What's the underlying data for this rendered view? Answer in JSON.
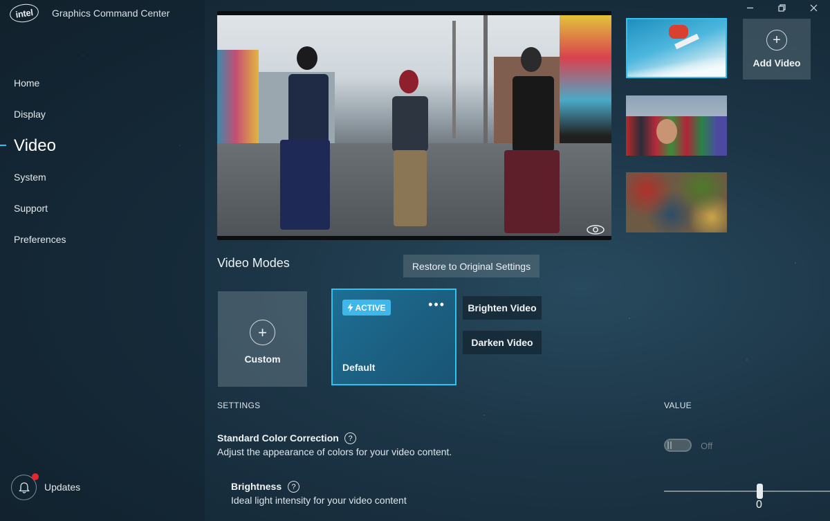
{
  "app": {
    "logo": "intel",
    "title": "Graphics Command Center"
  },
  "nav": {
    "items": [
      {
        "label": "Home"
      },
      {
        "label": "Display"
      },
      {
        "label": "Video",
        "active": true
      },
      {
        "label": "System"
      },
      {
        "label": "Support"
      },
      {
        "label": "Preferences"
      }
    ],
    "updates_label": "Updates",
    "accent_color": "#2ec4f0"
  },
  "window_controls": {
    "icons": [
      "minimize-icon",
      "restore-icon",
      "close-icon"
    ]
  },
  "preview": {
    "overlay_icon": "eye-icon"
  },
  "thumbnails": {
    "items": [
      {
        "subject": "snowboarder",
        "selected": true
      },
      {
        "subject": "crowd"
      },
      {
        "subject": "market"
      }
    ],
    "add_label": "Add Video"
  },
  "video_modes": {
    "title": "Video Modes",
    "restore_label": "Restore to Original Settings",
    "custom_label": "Custom",
    "default_card": {
      "badge": "ACTIVE",
      "label": "Default",
      "menu_icon": "more-icon"
    },
    "menu_options": [
      "Brighten Video",
      "Darken Video"
    ]
  },
  "settings": {
    "header_settings": "SETTINGS",
    "header_value": "VALUE",
    "color_correction": {
      "title": "Standard Color Correction",
      "description": "Adjust the appearance of colors for your video content.",
      "toggle_state": "Off"
    },
    "brightness": {
      "title": "Brightness",
      "description": "Ideal light intensity for your video content",
      "value": "0"
    }
  }
}
